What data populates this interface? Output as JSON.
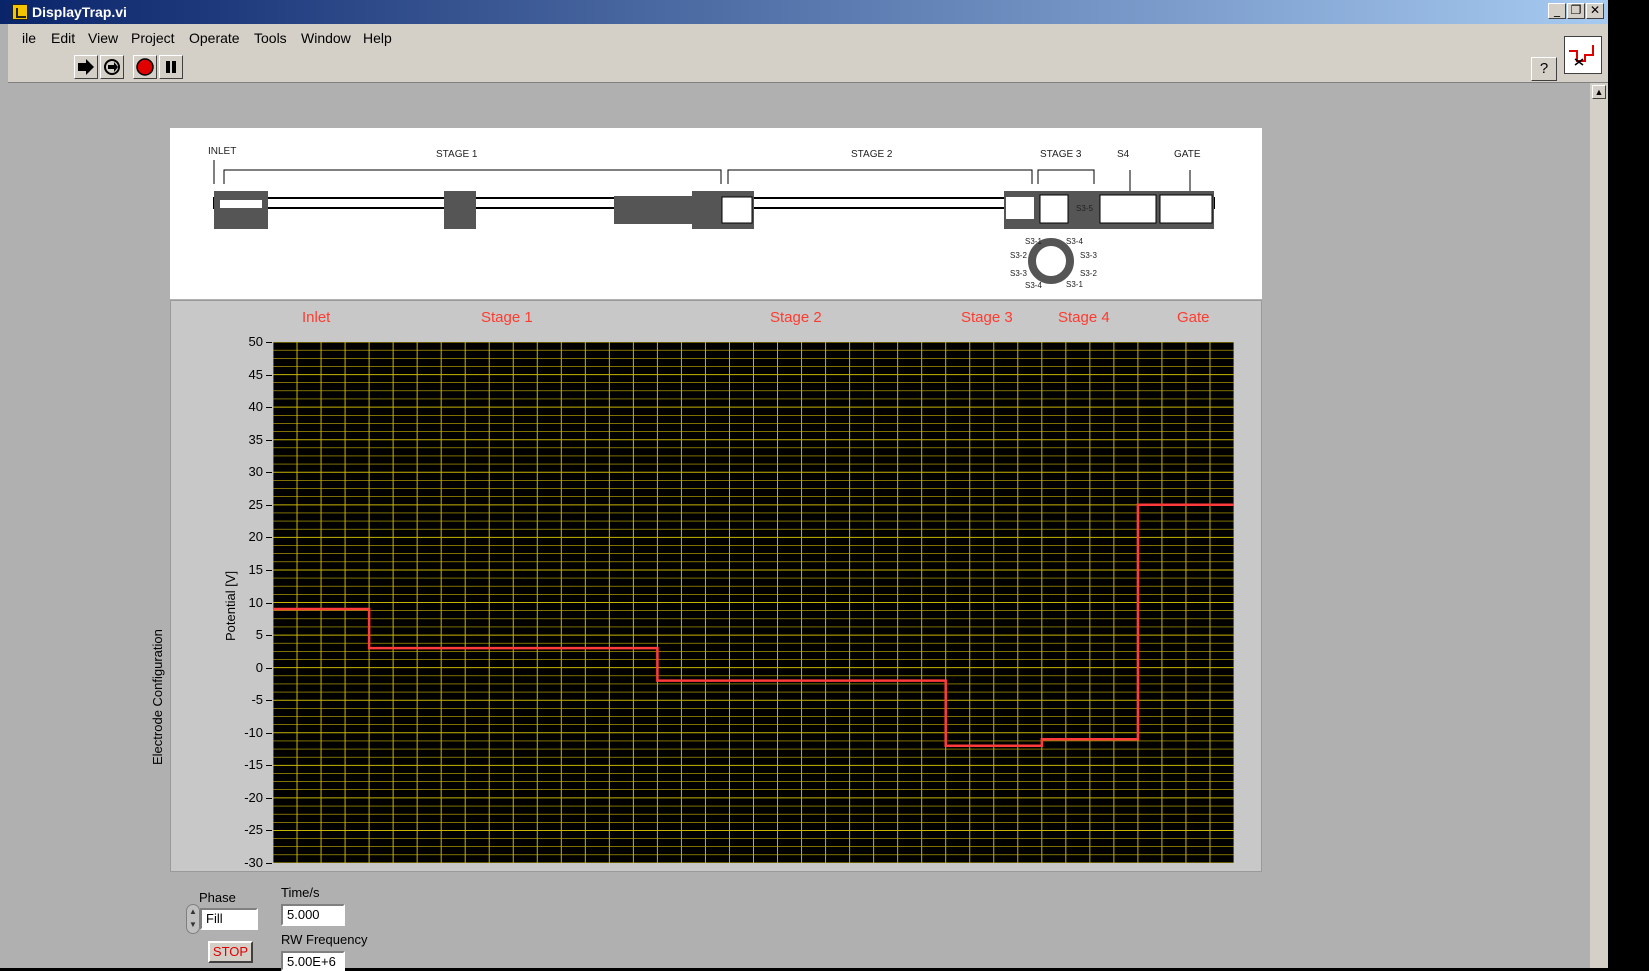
{
  "window": {
    "title": "DisplayTrap.vi",
    "minimize": "_",
    "restore": "❐",
    "close": "✕"
  },
  "menu": [
    "ile",
    "Edit",
    "View",
    "Project",
    "Operate",
    "Tools",
    "Window",
    "Help"
  ],
  "toolbar": {
    "run_icon": "run-arrow-icon",
    "run_continuously_icon": "run-continuously-icon",
    "abort_icon": "abort-icon",
    "pause_icon": "pause-icon",
    "help_label": "?"
  },
  "schematic": {
    "labels": [
      "INLET",
      "STAGE 1",
      "STAGE 2",
      "STAGE 3",
      "S4",
      "GATE"
    ],
    "electrode_labels": [
      "S3-1",
      "S3-4",
      "S3-2",
      "S3-3",
      "S3-3",
      "S3-2",
      "S3-4",
      "S3-1",
      "S3-5"
    ]
  },
  "chart_data": {
    "type": "line",
    "title": "",
    "group_label": "Electrode Configuration",
    "ylabel": "Potential [V]",
    "xlabel": "",
    "ylim": [
      -30,
      50
    ],
    "yticks": [
      50,
      45,
      40,
      35,
      30,
      25,
      20,
      15,
      10,
      5,
      0,
      -5,
      -10,
      -15,
      -20,
      -25,
      -30
    ],
    "stage_labels": [
      "Inlet",
      "Stage 1",
      "Stage 2",
      "Stage 3",
      "Stage 4",
      "Gate"
    ],
    "grid": true,
    "series": [
      {
        "color": "#ff3b3b",
        "x_fraction": [
          0,
          0.1,
          0.1,
          0.4,
          0.4,
          0.7,
          0.7,
          0.8,
          0.8,
          0.9,
          0.9,
          1.0
        ],
        "values": [
          9,
          9,
          3,
          3,
          -2,
          -2,
          -12,
          -12,
          -11,
          -11,
          25,
          25
        ]
      }
    ],
    "colors": {
      "plot_bg": "#000000",
      "grid": "#c8b400",
      "trace": "#ff3b3b",
      "stage_label": "#ff3b2f"
    }
  },
  "controls": {
    "phase_label": "Phase",
    "phase_value": "Fill",
    "time_label": "Time/s",
    "time_value": "5.000",
    "rw_label": "RW Frequency",
    "rw_value": "5.00E+6",
    "stop_label": "STOP"
  }
}
